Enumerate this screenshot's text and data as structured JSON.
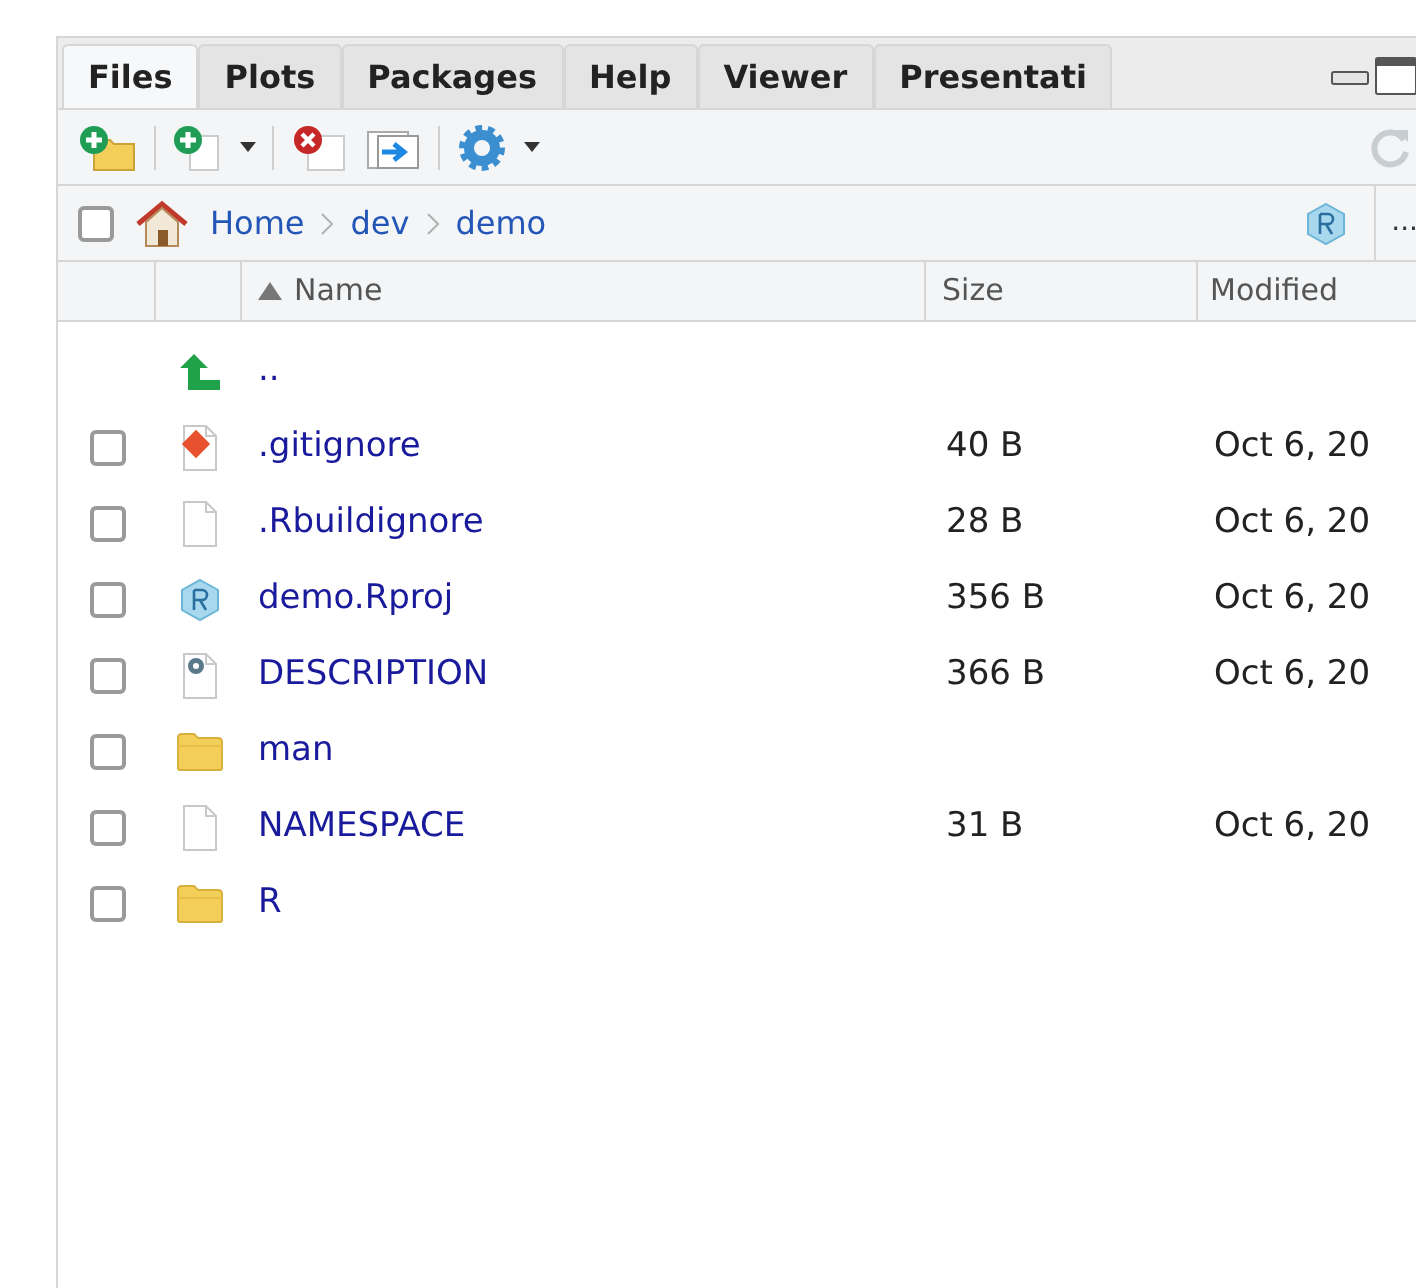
{
  "tabs": [
    {
      "label": "Files",
      "selected": true
    },
    {
      "label": "Plots",
      "selected": false
    },
    {
      "label": "Packages",
      "selected": false
    },
    {
      "label": "Help",
      "selected": false
    },
    {
      "label": "Viewer",
      "selected": false
    },
    {
      "label": "Presentati",
      "selected": false
    }
  ],
  "breadcrumb": {
    "checked": false,
    "parts": [
      "Home",
      "dev",
      "demo"
    ],
    "more": "..."
  },
  "table": {
    "columns": [
      "Name",
      "Size",
      "Modified"
    ],
    "rows": [
      {
        "kind": "up",
        "name": ".."
      },
      {
        "kind": "git",
        "name": ".gitignore",
        "size": "40 B",
        "modified": "Oct 6, 20",
        "checked": false
      },
      {
        "kind": "file",
        "name": ".Rbuildignore",
        "size": "28 B",
        "modified": "Oct 6, 20",
        "checked": false
      },
      {
        "kind": "rproj",
        "name": "demo.Rproj",
        "size": "356 B",
        "modified": "Oct 6, 20",
        "checked": false
      },
      {
        "kind": "config",
        "name": "DESCRIPTION",
        "size": "366 B",
        "modified": "Oct 6, 20",
        "checked": false
      },
      {
        "kind": "folder",
        "name": "man",
        "checked": false
      },
      {
        "kind": "file",
        "name": "NAMESPACE",
        "size": "31 B",
        "modified": "Oct 6, 20",
        "checked": false
      },
      {
        "kind": "folder",
        "name": "R",
        "checked": false
      }
    ]
  }
}
